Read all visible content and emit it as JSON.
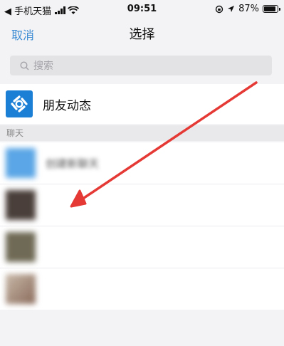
{
  "status_bar": {
    "back_app": "◀ 手机天猫",
    "time": "09:51",
    "battery_percent": "87%"
  },
  "nav": {
    "cancel_label": "取消",
    "title": "选择"
  },
  "search": {
    "placeholder": "搜索"
  },
  "moments": {
    "label": "朋友动态"
  },
  "section": {
    "chats_header": "聊天"
  },
  "chats": [
    {
      "name": "创建新聊天",
      "avatar_color": "#5aa6e6"
    },
    {
      "name": "",
      "avatar_color": "#4a3f3a"
    },
    {
      "name": "",
      "avatar_color": "#6f6a55"
    },
    {
      "name": "",
      "avatar_color": "#a88b7b"
    }
  ],
  "colors": {
    "accent": "#3a8bd3",
    "arrow": "#e53935"
  }
}
